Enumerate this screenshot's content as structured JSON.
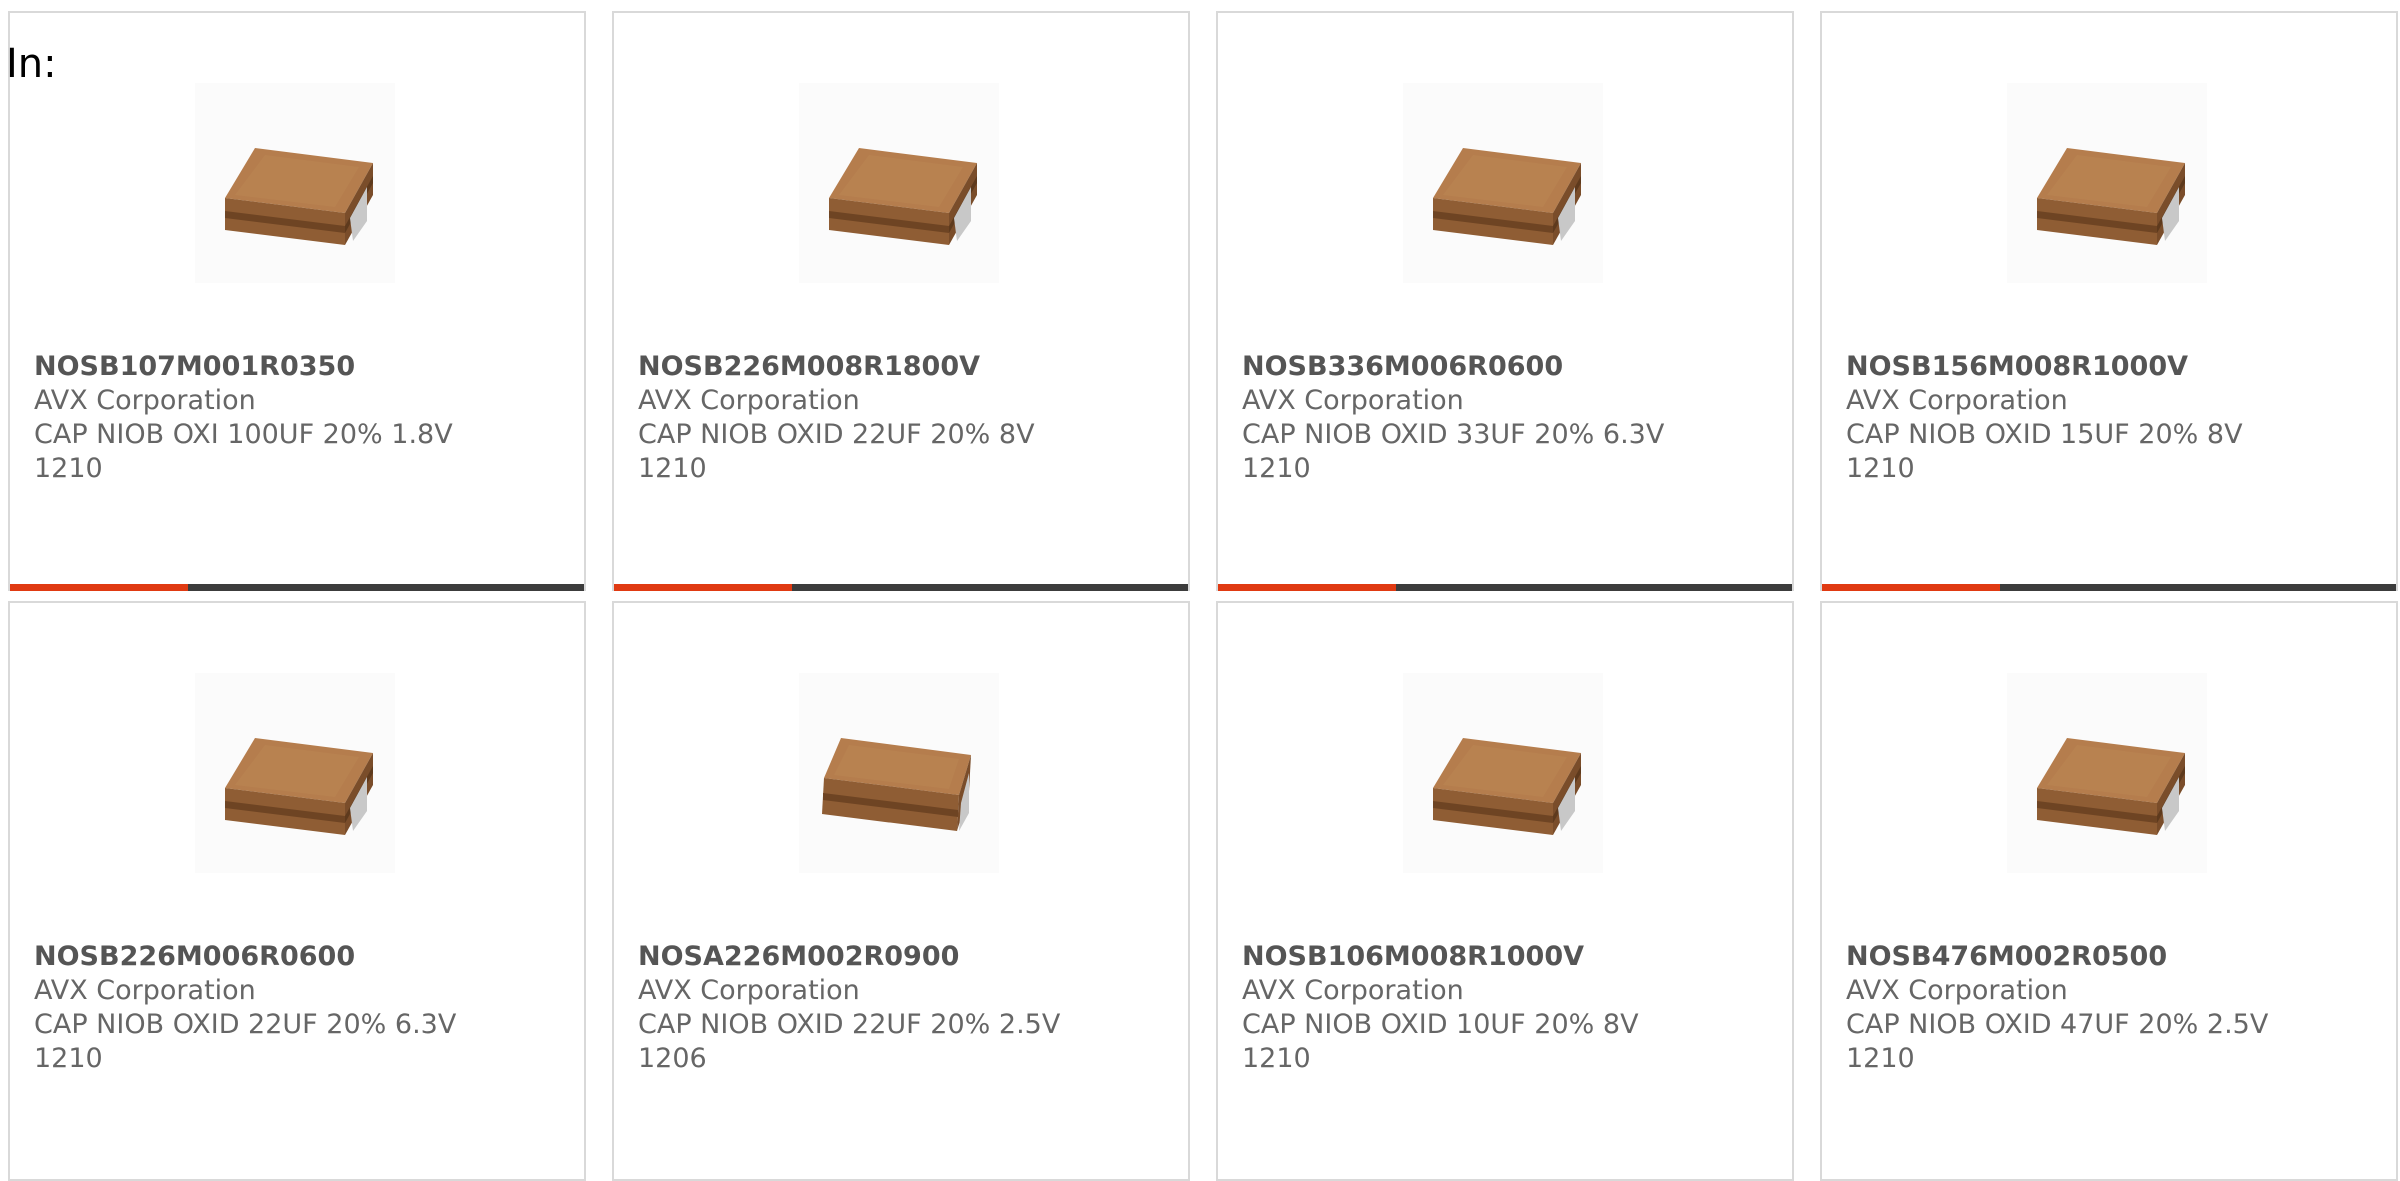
{
  "header": {
    "in_label": "In:"
  },
  "colors": {
    "accent": "#e03a12",
    "bar_track": "#3c3c3c",
    "card_border": "#d9d9d9"
  },
  "products": [
    {
      "part_number": "NOSB107M001R0350",
      "manufacturer": "AVX Corporation",
      "description": "CAP NIOB OXI 100UF 20% 1.8V",
      "package": "1210",
      "image_icon": "capacitor-chip-image",
      "progress": 0.31
    },
    {
      "part_number": "NOSB226M008R1800V",
      "manufacturer": "AVX Corporation",
      "description": "CAP NIOB OXID 22UF 20% 8V",
      "package": "1210",
      "image_icon": "capacitor-chip-image",
      "progress": 0.31
    },
    {
      "part_number": "NOSB336M006R0600",
      "manufacturer": "AVX Corporation",
      "description": "CAP NIOB OXID 33UF 20% 6.3V",
      "package": "1210",
      "image_icon": "capacitor-chip-image",
      "progress": 0.31
    },
    {
      "part_number": "NOSB156M008R1000V",
      "manufacturer": "AVX Corporation",
      "description": "CAP NIOB OXID 15UF 20% 8V",
      "package": "1210",
      "image_icon": "capacitor-chip-image",
      "progress": 0.31
    },
    {
      "part_number": "NOSB226M006R0600",
      "manufacturer": "AVX Corporation",
      "description": "CAP NIOB OXID 22UF 20% 6.3V",
      "package": "1210",
      "image_icon": "capacitor-chip-image",
      "progress": 0.31
    },
    {
      "part_number": "NOSA226M002R0900",
      "manufacturer": "AVX Corporation",
      "description": "CAP NIOB OXID 22UF 20% 2.5V",
      "package": "1206",
      "image_icon": "capacitor-chip-image",
      "progress": 0.31
    },
    {
      "part_number": "NOSB106M008R1000V",
      "manufacturer": "AVX Corporation",
      "description": "CAP NIOB OXID 10UF 20% 8V",
      "package": "1210",
      "image_icon": "capacitor-chip-image",
      "progress": 0.31
    },
    {
      "part_number": "NOSB476M002R0500",
      "manufacturer": "AVX Corporation",
      "description": "CAP NIOB OXID 47UF 20% 2.5V",
      "package": "1210",
      "image_icon": "capacitor-chip-image",
      "progress": 0.31
    }
  ]
}
